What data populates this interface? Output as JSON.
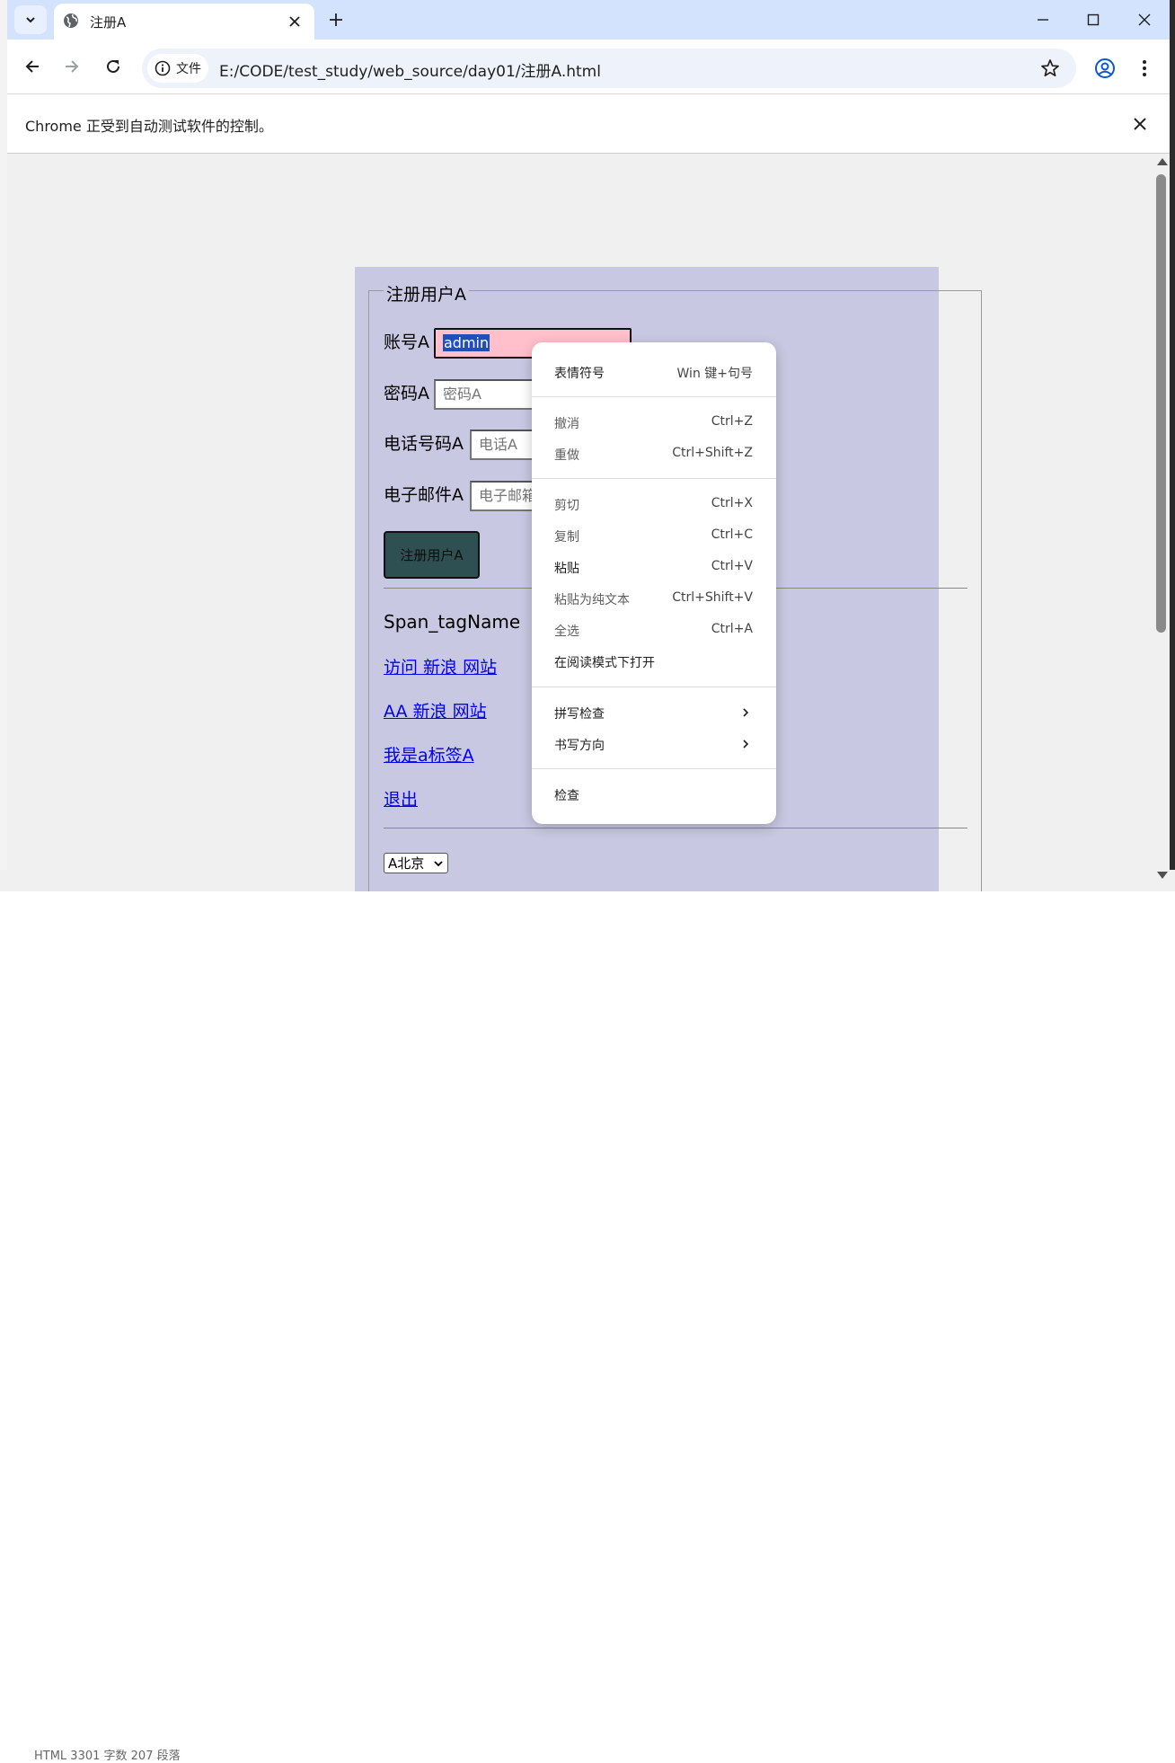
{
  "browser": {
    "tab_title": "注册A",
    "address_chip": "文件",
    "url": "E:/CODE/test_study/web_source/day01/注册A.html",
    "infobar_text": "Chrome 正受到自动测试软件的控制。"
  },
  "page": {
    "legend": "注册用户A",
    "account_label": "账号A",
    "account_value": "admin",
    "password_label": "密码A",
    "password_placeholder": "密码A",
    "phone_label": "电话号码A",
    "phone_placeholder": "电话A",
    "email_label": "电子邮件A",
    "email_placeholder": "电子邮箱A",
    "submit_label": "注册用户A",
    "span_text": "Span_tagName",
    "links": [
      "访问 新浪 网站",
      "AA 新浪 网站",
      "我是a标签A",
      "退出"
    ],
    "select_value": "A北京"
  },
  "context_menu": {
    "emoji": {
      "label": "表情符号",
      "shortcut": "Win 键+句号"
    },
    "undo": {
      "label": "撤消",
      "shortcut": "Ctrl+Z"
    },
    "redo": {
      "label": "重做",
      "shortcut": "Ctrl+Shift+Z"
    },
    "cut": {
      "label": "剪切",
      "shortcut": "Ctrl+X"
    },
    "copy": {
      "label": "复制",
      "shortcut": "Ctrl+C"
    },
    "paste": {
      "label": "粘贴",
      "shortcut": "Ctrl+V"
    },
    "paste_plain": {
      "label": "粘贴为纯文本",
      "shortcut": "Ctrl+Shift+V"
    },
    "select_all": {
      "label": "全选",
      "shortcut": "Ctrl+A"
    },
    "reading_mode": {
      "label": "在阅读模式下打开"
    },
    "spellcheck": {
      "label": "拼写检查"
    },
    "writing_direction": {
      "label": "书写方向"
    },
    "inspect": {
      "label": "检查"
    }
  },
  "background": {
    "status_text": "HTML 3301 字数 207 段落"
  },
  "colors": {
    "tab_strip": "#d3e3fd",
    "page_bg": "#c8c8e2",
    "active_input": "#ffc0cb",
    "submit_button": "#2f5052",
    "link": "#0000ee",
    "selection": "#1f4fba"
  }
}
